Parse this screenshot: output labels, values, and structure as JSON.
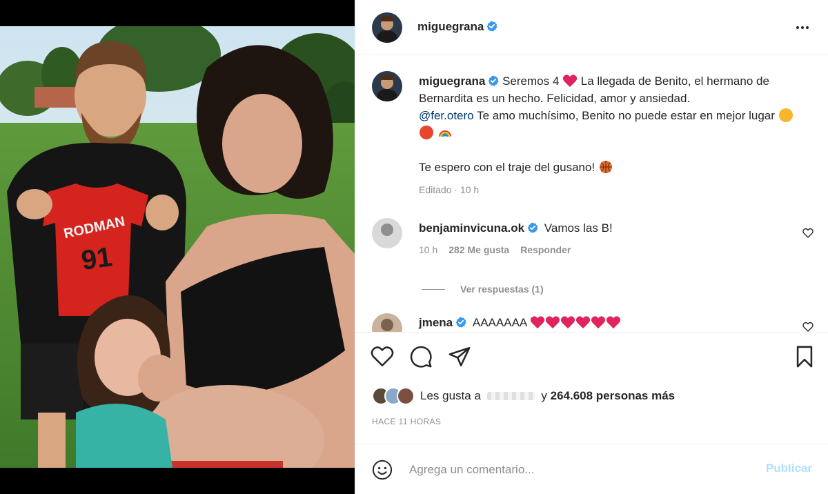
{
  "post": {
    "username": "miguegrana",
    "caption": {
      "part1": "Seremos 4",
      "part2": "La llegada de Benito, el hermano de Bernardita es un hecho. Felicidad, amor y ansiedad.",
      "mention": "@fer.otero",
      "part3": "Te amo muchísimo, Benito no puede estar en mejor lugar",
      "part4": "Te espero con el traje del gusano!"
    },
    "edited": "Editado · 10 h"
  },
  "comments": [
    {
      "username": "benjaminvicuna.ok",
      "text": "Vamos las B!",
      "time": "10 h",
      "likes": "282 Me gusta",
      "reply": "Responder",
      "view_replies": "Ver respuestas (1)"
    },
    {
      "username": "jmena",
      "text": "AAAAAAA"
    }
  ],
  "actions": {
    "likes_prefix": "Les gusta a",
    "likes_suffix": "y",
    "likes_count": "264.608 personas más",
    "time_ago": "HACE 11 HORAS"
  },
  "comment_box": {
    "placeholder": "Agrega un comentario...",
    "publish": "Publicar"
  },
  "photo": {
    "jersey_name": "RODMAN",
    "jersey_number": "91"
  },
  "colors": {
    "verified": "#3897f0",
    "mention": "#00376b",
    "publish_disabled": "#b2dffc",
    "heart": "#ed4956"
  }
}
